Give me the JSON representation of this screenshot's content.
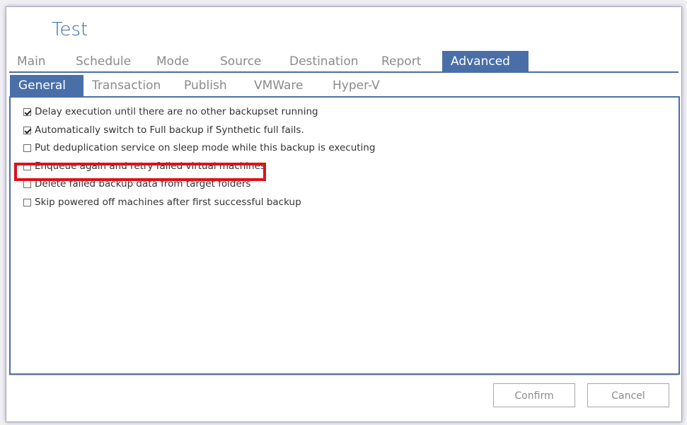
{
  "window": {
    "title": "Test"
  },
  "main_tabs": [
    {
      "label": "Main"
    },
    {
      "label": "Schedule"
    },
    {
      "label": "Mode"
    },
    {
      "label": "Source"
    },
    {
      "label": "Destination"
    },
    {
      "label": "Report"
    },
    {
      "label": "Advanced",
      "active": true
    }
  ],
  "sub_tabs": [
    {
      "label": "General",
      "active": true
    },
    {
      "label": "Transaction"
    },
    {
      "label": "Publish"
    },
    {
      "label": "VMWare"
    },
    {
      "label": "Hyper-V"
    }
  ],
  "options": [
    {
      "label": "Delay execution until there are no other backupset running",
      "checked": true
    },
    {
      "label": "Automatically switch to Full backup if Synthetic full fails.",
      "checked": true
    },
    {
      "label": "Put deduplication service on sleep mode while this backup is executing",
      "checked": false
    },
    {
      "label": "Enqueue again and retry failed virtual machines",
      "checked": false,
      "highlighted": true
    },
    {
      "label": "Delete failed backup data from target folders",
      "checked": false
    },
    {
      "label": "Skip powered off machines after first successful backup",
      "checked": false
    }
  ],
  "buttons": {
    "confirm": "Confirm",
    "cancel": "Cancel"
  },
  "colors": {
    "accent": "#4a6fa8",
    "highlight": "#e0101a",
    "title": "#3b6aa8"
  }
}
